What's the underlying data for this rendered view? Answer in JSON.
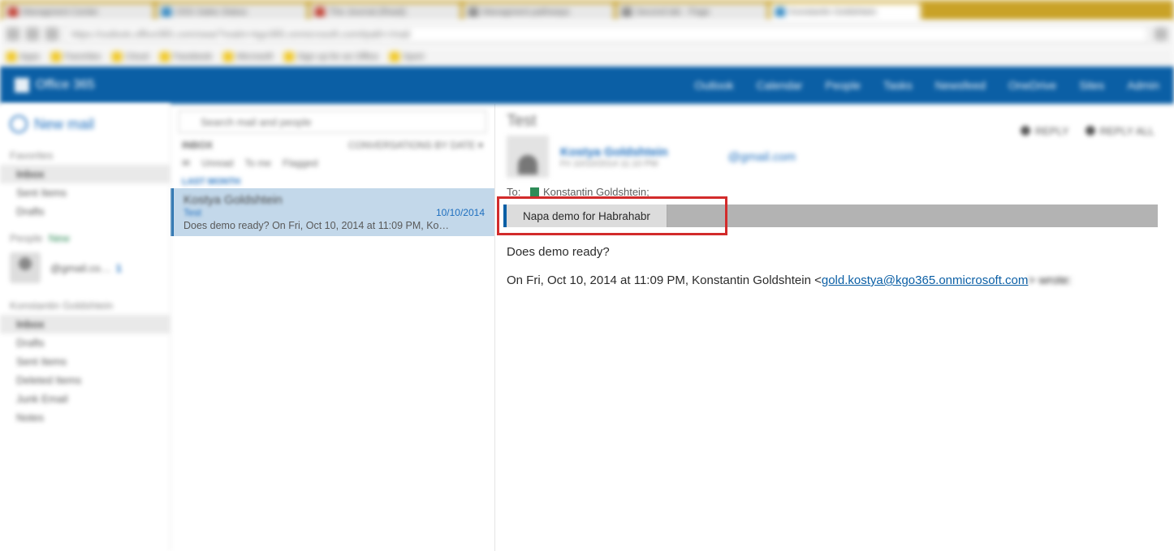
{
  "browser": {
    "tabs": [
      "Managment Center",
      "OSS Sales Status",
      "The Journal (Read)",
      "Managment pathways",
      "Second tab · Page",
      "Konstantin Goldshtein"
    ],
    "url": "https://outlook.office365.com/owa/?realm=kgo365.onmicrosoft.com#path=/mail",
    "bookmarks": [
      "Apps",
      "Favorites",
      "Cloud",
      "Facebook",
      "Microsoft",
      "Sign up for an Office",
      "Sport"
    ]
  },
  "o365": {
    "brand": "Office 365",
    "nav": [
      "Outlook",
      "Calendar",
      "People",
      "Tasks",
      "Newsfeed",
      "OneDrive",
      "Sites",
      "Admin"
    ]
  },
  "sidebar": {
    "new_mail": "New mail",
    "favorites_title": "Favorites",
    "favorites": [
      "Inbox",
      "Sent Items",
      "Drafts"
    ],
    "people_title": "People",
    "people_new": "New",
    "contact_email": "@gmail.co…",
    "contact_badge": "1",
    "account_title": "Konstantin Goldshtein",
    "folders": [
      "Inbox",
      "Drafts",
      "Sent Items",
      "Deleted Items",
      "Junk Email",
      "Notes"
    ]
  },
  "list": {
    "search_placeholder": "Search mail and people",
    "folder_label": "INBOX",
    "sort_label": "CONVERSATIONS BY DATE ▾",
    "filters": [
      "All",
      "Unread",
      "To me",
      "Flagged"
    ],
    "section": "LAST MONTH",
    "items": [
      {
        "from": "Kostya Goldshtein",
        "subject": "Test",
        "date": "10/10/2014",
        "preview": "Does demo ready?  On Fri, Oct 10, 2014 at 11:09 PM, Ko…"
      }
    ]
  },
  "reading": {
    "subject": "Test",
    "reply": "REPLY",
    "reply_all": "REPLY ALL",
    "sender_name": "Kostya Goldshtein",
    "sender_ts": "Fri 10/10/2014 11:10 PM",
    "sender_email": "@gmail.com",
    "to_label": "To:",
    "to_name": "Konstantin Goldshtein;",
    "addin_tab": "Napa demo for Habrahabr",
    "body_line1": "Does demo ready?",
    "quote_prefix": "On Fri, Oct 10, 2014 at 11:09 PM, Konstantin Goldshtein <",
    "quote_email": "gold.kostya@kgo365.onmicrosoft.com",
    "quote_suffix": "> wrote:"
  }
}
